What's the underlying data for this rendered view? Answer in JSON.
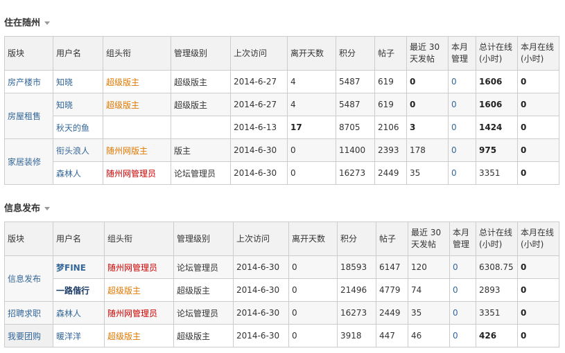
{
  "sections": [
    {
      "title": "住在随州",
      "headers": [
        "版块",
        "用户名",
        "组头衔",
        "管理级别",
        "上次访问",
        "离开天数",
        "积分",
        "帖子",
        "最近 30 天发帖",
        "本月管理",
        "总计在线(小时)",
        "本月在线(小时)"
      ],
      "rows": [
        {
          "board": "房产楼市",
          "user": "知晓",
          "title": "超级版主",
          "level": "超级版主",
          "last": "2014-6-27",
          "away": "4",
          "score": "5487",
          "posts": "619",
          "recent": "0",
          "manage": "0",
          "total": "1606",
          "month": "0"
        },
        {
          "board": "房屋租售",
          "user": "知晓",
          "title": "超级版主",
          "level": "超级版主",
          "last": "2014-6-27",
          "away": "4",
          "score": "5487",
          "posts": "619",
          "recent": "0",
          "manage": "0",
          "total": "1606",
          "month": "0"
        },
        {
          "board": "",
          "user": "秋天的鱼",
          "title": "",
          "level": "",
          "last": "2014-6-13",
          "away": "17",
          "score": "8705",
          "posts": "2106",
          "recent": "3",
          "manage": "0",
          "total": "1424",
          "month": "0"
        },
        {
          "board": "家居装修",
          "user": "衔头浪人",
          "title": "随州网版主",
          "level": "版主",
          "last": "2014-6-30",
          "away": "0",
          "score": "11400",
          "posts": "2393",
          "recent": "178",
          "manage": "0",
          "total": "975",
          "month": "0"
        },
        {
          "board": "",
          "user": "森林人",
          "title": "随州网管理员",
          "level": "论坛管理员",
          "last": "2014-6-30",
          "away": "0",
          "score": "16273",
          "posts": "2449",
          "recent": "35",
          "manage": "0",
          "total": "3351",
          "month": "0"
        }
      ]
    },
    {
      "title": "信息发布",
      "headers": [
        "版块",
        "用户名",
        "组头衔",
        "管理级别",
        "上次访问",
        "离开天数",
        "积分",
        "帖子",
        "最近 30 天发帖",
        "本月管理",
        "总计在线(小时)",
        "本月在线(小时)"
      ],
      "rows": [
        {
          "board": "信息发布",
          "user": "梦FINE",
          "title": "随州网管理员",
          "level": "论坛管理员",
          "last": "2014-6-30",
          "away": "0",
          "score": "18593",
          "posts": "6147",
          "recent": "120",
          "manage": "0",
          "total": "6308.75",
          "month": "0"
        },
        {
          "board": "",
          "user": "一路偕行",
          "title": "超级版主",
          "level": "超级版主",
          "last": "2014-6-30",
          "away": "0",
          "score": "21496",
          "posts": "4779",
          "recent": "74",
          "manage": "0",
          "total": "2893",
          "month": "0"
        },
        {
          "board": "招聘求职",
          "user": "森林人",
          "title": "随州网管理员",
          "level": "论坛管理员",
          "last": "2014-6-30",
          "away": "0",
          "score": "16273",
          "posts": "2449",
          "recent": "35",
          "manage": "0",
          "total": "3351",
          "month": "0"
        },
        {
          "board": "我要团购",
          "user": "暖洋洋",
          "title": "超级版主",
          "level": "超级版主",
          "last": "2014-6-30",
          "away": "0",
          "score": "3918",
          "posts": "447",
          "recent": "46",
          "manage": "0",
          "total": "426",
          "month": "0"
        }
      ]
    }
  ]
}
